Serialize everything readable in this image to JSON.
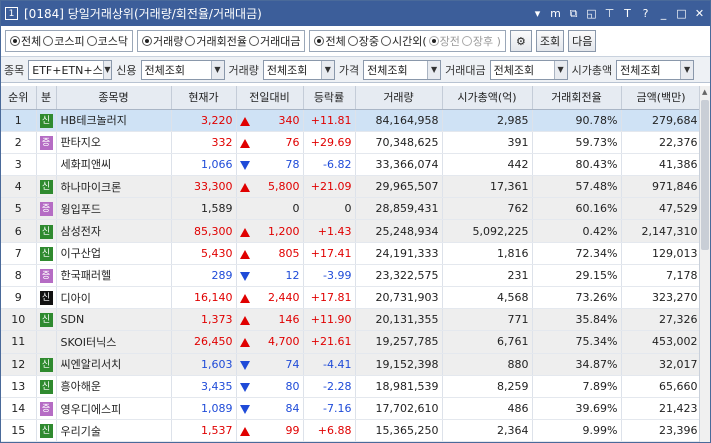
{
  "window": {
    "screen_no": "1",
    "title": "[0184] 당일거래상위(거래량/회전율/거래대금)",
    "tools": [
      "▾",
      "m",
      "⧉",
      "◱",
      "⊤",
      "T",
      "?",
      "_",
      "□",
      "✕"
    ]
  },
  "options": {
    "market": [
      {
        "label": "전체",
        "on": true
      },
      {
        "label": "코스피",
        "on": false
      },
      {
        "label": "코스닥",
        "on": false
      }
    ],
    "sort": [
      {
        "label": "거래량",
        "on": true
      },
      {
        "label": "거래회전율",
        "on": false
      },
      {
        "label": "거래대금",
        "on": false
      }
    ],
    "session": [
      {
        "label": "전체",
        "on": true,
        "disabled": false
      },
      {
        "label": "장중",
        "on": false,
        "disabled": false
      },
      {
        "label": "시간외(",
        "on": false,
        "disabled": false
      },
      {
        "label": "장전",
        "on": true,
        "disabled": true
      },
      {
        "label": "장후 )",
        "on": false,
        "disabled": true
      }
    ],
    "query_label": "조회",
    "next_label": "다음"
  },
  "filters": [
    {
      "label": "종목",
      "value": "ETF+ETN+스"
    },
    {
      "label": "신용",
      "value": "전체조회"
    },
    {
      "label": "거래량",
      "value": "전체조회"
    },
    {
      "label": "가격",
      "value": "전체조회"
    },
    {
      "label": "거래대금",
      "value": "전체조회"
    },
    {
      "label": "시가총액",
      "value": "전체조회"
    }
  ],
  "table": {
    "headers": [
      "순위",
      "분",
      "종목명",
      "현재가",
      "전일대비",
      "등락률",
      "거래량",
      "시가총액(억)",
      "거래회전율",
      "금액(백만)"
    ],
    "rows": [
      {
        "rank": "1",
        "badge": "신",
        "name": "HB테크놀러지",
        "price": "3,220",
        "dir": "up",
        "change": "340",
        "rate": "+11.81",
        "volume": "84,164,958",
        "cap": "2,985",
        "turnover": "90.78%",
        "amount": "279,684"
      },
      {
        "rank": "2",
        "badge": "증",
        "name": "판타지오",
        "price": "332",
        "dir": "up",
        "change": "76",
        "rate": "+29.69",
        "volume": "70,348,625",
        "cap": "391",
        "turnover": "59.73%",
        "amount": "22,376"
      },
      {
        "rank": "3",
        "badge": "",
        "name": "세화피앤씨",
        "price": "1,066",
        "dir": "down",
        "change": "78",
        "rate": "-6.82",
        "volume": "33,366,074",
        "cap": "442",
        "turnover": "80.43%",
        "amount": "41,386"
      },
      {
        "rank": "4",
        "badge": "신",
        "name": "하나마이크론",
        "price": "33,300",
        "dir": "up",
        "change": "5,800",
        "rate": "+21.09",
        "volume": "29,965,507",
        "cap": "17,361",
        "turnover": "57.48%",
        "amount": "971,846"
      },
      {
        "rank": "5",
        "badge": "증",
        "name": "윙입푸드",
        "price": "1,589",
        "dir": "flat",
        "change": "0",
        "rate": "0",
        "volume": "28,859,431",
        "cap": "762",
        "turnover": "60.16%",
        "amount": "47,529"
      },
      {
        "rank": "6",
        "badge": "신",
        "name": "삼성전자",
        "price": "85,300",
        "dir": "up",
        "change": "1,200",
        "rate": "+1.43",
        "volume": "25,248,934",
        "cap": "5,092,225",
        "turnover": "0.42%",
        "amount": "2,147,310"
      },
      {
        "rank": "7",
        "badge": "신",
        "name": "이구산업",
        "price": "5,430",
        "dir": "up",
        "change": "805",
        "rate": "+17.41",
        "volume": "24,191,333",
        "cap": "1,816",
        "turnover": "72.34%",
        "amount": "129,013"
      },
      {
        "rank": "8",
        "badge": "증",
        "name": "한국패러헬",
        "price": "289",
        "dir": "down",
        "change": "12",
        "rate": "-3.99",
        "volume": "23,322,575",
        "cap": "231",
        "turnover": "29.15%",
        "amount": "7,178"
      },
      {
        "rank": "9",
        "badge": "신",
        "name": "디아이",
        "price": "16,140",
        "dir": "up",
        "change": "2,440",
        "rate": "+17.81",
        "volume": "20,731,903",
        "cap": "4,568",
        "turnover": "73.26%",
        "amount": "323,270"
      },
      {
        "rank": "10",
        "badge": "신",
        "name": "SDN",
        "price": "1,373",
        "dir": "up",
        "change": "146",
        "rate": "+11.90",
        "volume": "20,131,355",
        "cap": "771",
        "turnover": "35.84%",
        "amount": "27,326"
      },
      {
        "rank": "11",
        "badge": "",
        "name": "SKOI터닉스",
        "price": "26,450",
        "dir": "up",
        "change": "4,700",
        "rate": "+21.61",
        "volume": "19,257,785",
        "cap": "6,761",
        "turnover": "75.34%",
        "amount": "453,002"
      },
      {
        "rank": "12",
        "badge": "신",
        "name": "씨엔알리서치",
        "price": "1,603",
        "dir": "down",
        "change": "74",
        "rate": "-4.41",
        "volume": "19,152,398",
        "cap": "880",
        "turnover": "34.87%",
        "amount": "32,017"
      },
      {
        "rank": "13",
        "badge": "신",
        "name": "흥아해운",
        "price": "3,435",
        "dir": "down",
        "change": "80",
        "rate": "-2.28",
        "volume": "18,981,539",
        "cap": "8,259",
        "turnover": "7.89%",
        "amount": "65,660"
      },
      {
        "rank": "14",
        "badge": "증",
        "name": "영우디에스피",
        "price": "1,089",
        "dir": "down",
        "change": "84",
        "rate": "-7.16",
        "volume": "17,702,610",
        "cap": "486",
        "turnover": "39.69%",
        "amount": "21,423"
      },
      {
        "rank": "15",
        "badge": "신",
        "name": "우리기술",
        "price": "1,537",
        "dir": "up",
        "change": "99",
        "rate": "+6.88",
        "volume": "15,365,250",
        "cap": "2,364",
        "turnover": "9.99%",
        "amount": "23,396"
      }
    ]
  },
  "colors": {
    "titlebar": "#3c5e9a",
    "up": "#e00000",
    "down": "#1f4bd8",
    "badge_credit": "#2f8a2f",
    "badge_securities": "#b56cc4",
    "badge_black": "#111111",
    "selected_row": "#cfe2f5"
  }
}
